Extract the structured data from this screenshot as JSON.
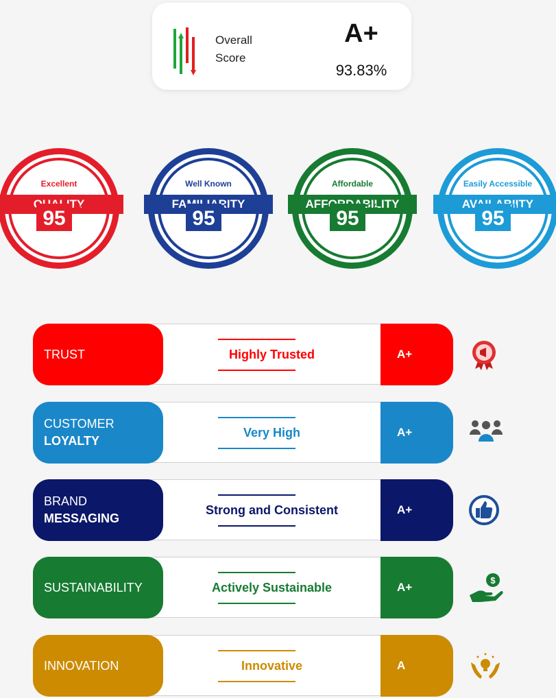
{
  "overall": {
    "label_line1": "Overall",
    "label_line2": "Score",
    "grade": "A+",
    "percent": "93.83%",
    "icon": "equalizer-sliders-icon"
  },
  "badges": [
    {
      "subtitle": "Excellent",
      "title": "QUALITY",
      "value": "95",
      "unit": "%",
      "color": "#e31e2a"
    },
    {
      "subtitle": "Well Known",
      "title": "FAMILIARITY",
      "value": "95",
      "unit": "%",
      "color": "#1e3f96"
    },
    {
      "subtitle": "Affordable",
      "title": "AFFORDABILITY",
      "value": "95",
      "unit": "%",
      "color": "#177b32"
    },
    {
      "subtitle": "Easily Accessible",
      "title": "AVAILABIITY",
      "value": "95",
      "unit": "%",
      "color": "#1d9bd7"
    }
  ],
  "ratings": [
    {
      "label_line1": "TRUST",
      "label_line2": "",
      "description": "Highly Trusted",
      "grade": "A+",
      "color": "#ff0000",
      "icon": "award-ribbon-icon"
    },
    {
      "label_line1": "CUSTOMER",
      "label_line2": "LOYALTY",
      "description": "Very High",
      "grade": "A+",
      "color": "#1a87c9",
      "icon": "people-group-icon"
    },
    {
      "label_line1": "BRAND",
      "label_line2": "MESSAGING",
      "description": "Strong and Consistent",
      "grade": "A+",
      "color": "#0b1769",
      "icon": "thumbs-up-icon"
    },
    {
      "label_line1": "SUSTAINABILITY",
      "label_line2": "",
      "description": "Actively Sustainable",
      "grade": "A+",
      "color": "#177b32",
      "icon": "money-hand-icon"
    },
    {
      "label_line1": "INNOVATION",
      "label_line2": "",
      "description": "Innovative",
      "grade": "A",
      "color": "#cc8b00",
      "icon": "idea-hands-icon"
    }
  ]
}
